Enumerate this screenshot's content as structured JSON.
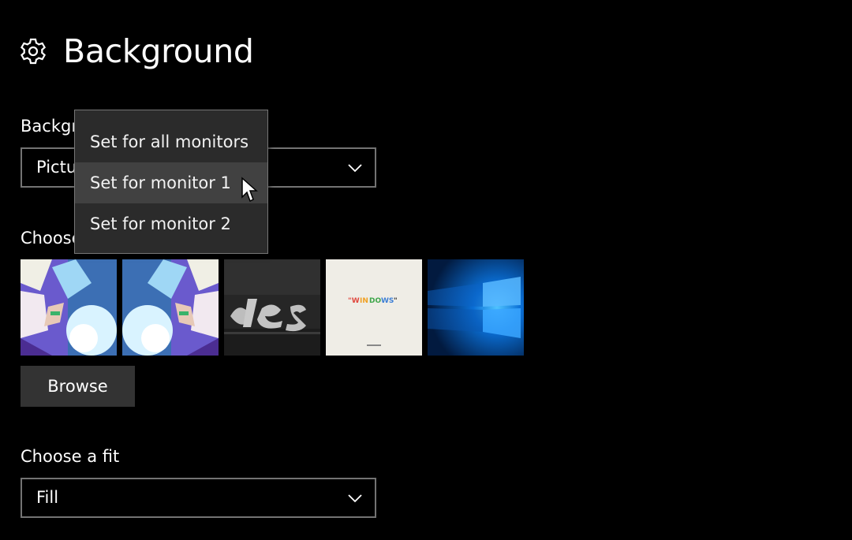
{
  "header": {
    "title": "Background",
    "icon": "gear-icon"
  },
  "background_section": {
    "label": "Background",
    "select_value": "Picture"
  },
  "choose_picture": {
    "label": "Choose your picture",
    "thumbnails": [
      "anime-character-1",
      "anime-character-2",
      "yes-text-wallpaper",
      "windows-text-wallpaper",
      "windows-10-hero-wallpaper"
    ],
    "browse_label": "Browse"
  },
  "fit_section": {
    "label": "Choose a fit",
    "select_value": "Fill"
  },
  "context_menu": {
    "items": [
      {
        "label": "Set for all monitors"
      },
      {
        "label": "Set for monitor 1"
      },
      {
        "label": "Set for monitor 2"
      }
    ]
  },
  "colors": {
    "background": "#000000",
    "menu_bg": "#2b2b2b",
    "menu_hover": "#414141",
    "button_bg": "#333333",
    "border": "#737373"
  }
}
